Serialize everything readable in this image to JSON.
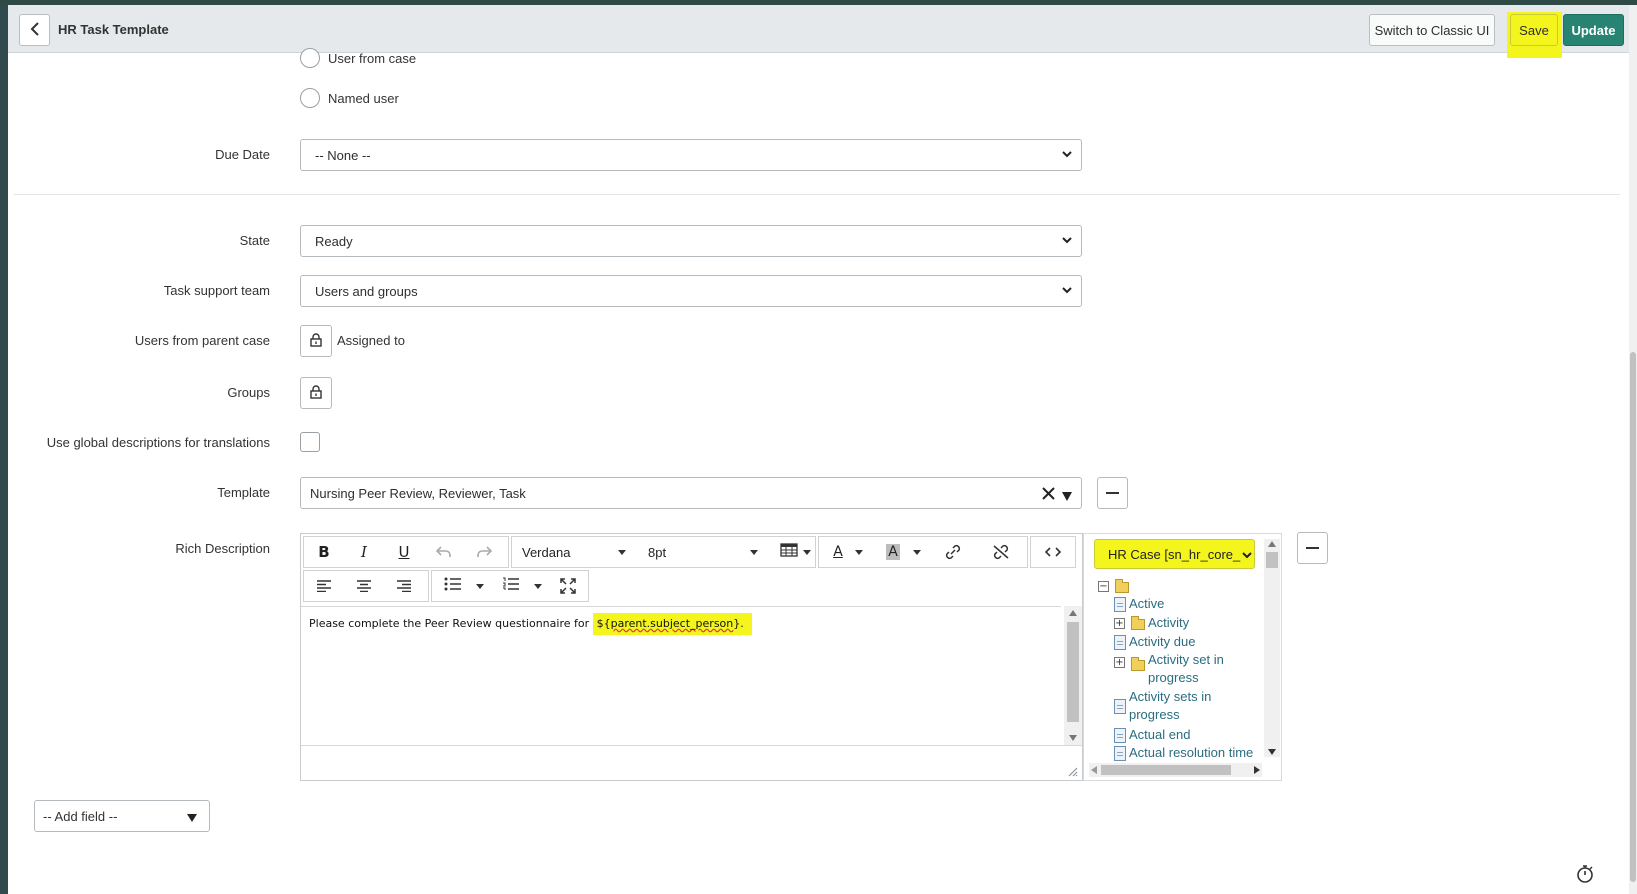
{
  "header": {
    "title": "HR Task Template",
    "switch_classic_label": "Switch to Classic UI",
    "save_label": "Save",
    "update_label": "Update"
  },
  "assignment": {
    "options": [
      {
        "label": "User from case"
      },
      {
        "label": "Named user"
      }
    ]
  },
  "due_date": {
    "label": "Due Date",
    "value": "-- None --"
  },
  "state": {
    "label": "State",
    "value": "Ready"
  },
  "task_support_team": {
    "label": "Task support team",
    "value": "Users and groups"
  },
  "users_from_parent_case": {
    "label": "Users from parent case",
    "value": "Assigned to"
  },
  "groups": {
    "label": "Groups"
  },
  "use_global_descriptions": {
    "label": "Use global descriptions for translations",
    "checked": false
  },
  "template": {
    "label": "Template",
    "value": "Nursing Peer Review, Reviewer, Task"
  },
  "rich_description": {
    "label": "Rich Description",
    "font_family": "Verdana",
    "font_size": "8pt",
    "text_before": "Please complete the Peer Review questionnaire for ",
    "token_prefix": "${",
    "token_var": "parent.subject_person",
    "token_suffix": "}.",
    "highlight_color": "#f5f51e"
  },
  "field_picker": {
    "table": "HR Case [sn_hr_core_",
    "items": [
      {
        "label": "Active",
        "type": "field"
      },
      {
        "label": "Activity",
        "type": "folder"
      },
      {
        "label": "Activity due",
        "type": "field"
      },
      {
        "label": "Activity set in progress",
        "type": "folder"
      },
      {
        "label": "Activity sets in progress",
        "type": "field"
      },
      {
        "label": "Actual end",
        "type": "field"
      },
      {
        "label": "Actual resolution time",
        "type": "field"
      }
    ]
  },
  "add_field": {
    "value": "-- Add field --"
  },
  "colors": {
    "accent": "#278473",
    "highlight": "#f5f51e",
    "link": "#2a6d80",
    "header_bg": "#e6e9eb"
  }
}
